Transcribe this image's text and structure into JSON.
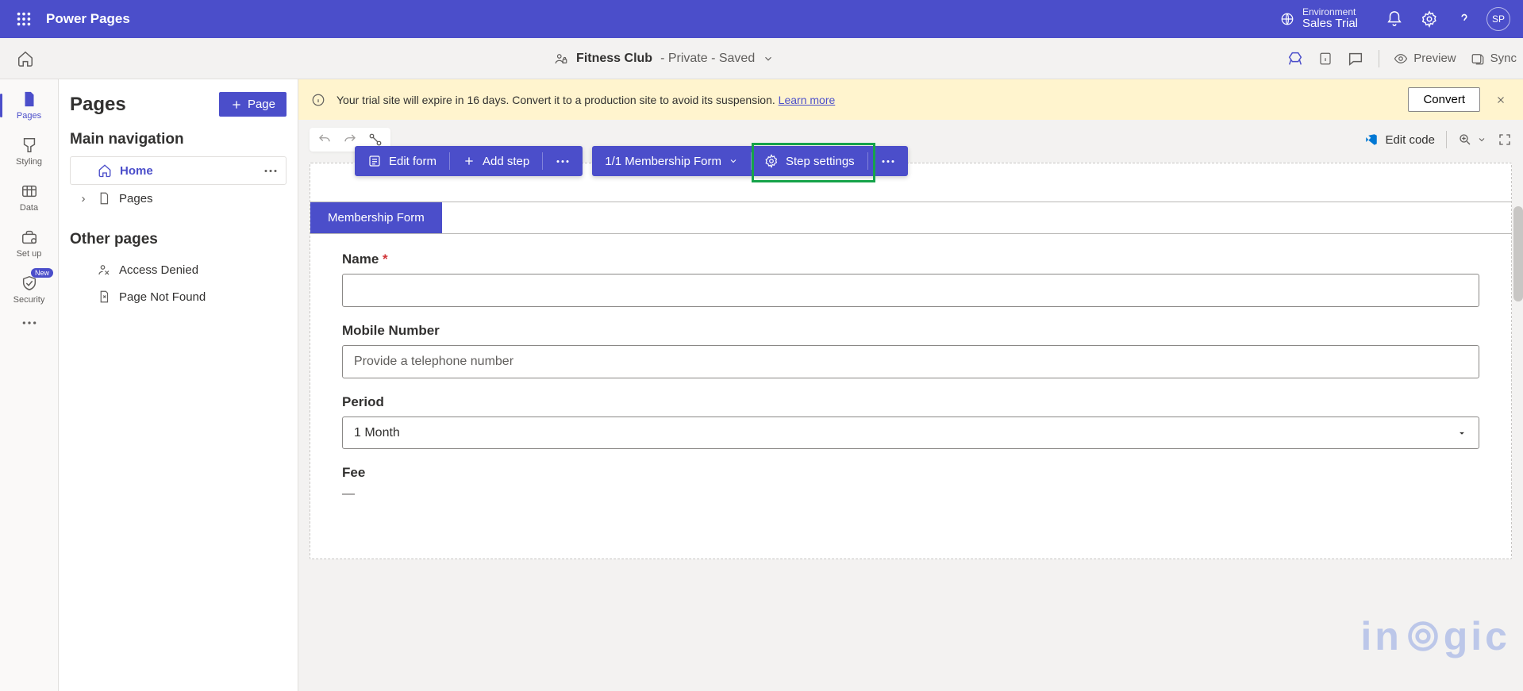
{
  "app_title": "Power Pages",
  "environment": {
    "label": "Environment",
    "name": "Sales Trial"
  },
  "avatar_initials": "SP",
  "subbar": {
    "site_name": "Fitness Club",
    "site_meta": " - Private - Saved",
    "preview": "Preview",
    "sync": "Sync"
  },
  "leftrail": {
    "pages": "Pages",
    "styling": "Styling",
    "data": "Data",
    "setup": "Set up",
    "security": "Security",
    "new_badge": "New"
  },
  "sidepanel": {
    "title": "Pages",
    "add_page": "Page",
    "main_nav": "Main navigation",
    "home": "Home",
    "pages_item": "Pages",
    "other_pages": "Other pages",
    "access_denied": "Access Denied",
    "not_found": "Page Not Found"
  },
  "banner": {
    "message_a": "Your trial site will expire in 16 days. Convert it to a production site to avoid its suspension. ",
    "learn_more": "Learn more",
    "convert": "Convert"
  },
  "toolbar": {
    "edit_code": "Edit code"
  },
  "floating": {
    "edit_form": "Edit form",
    "add_step": "Add step",
    "step_counter": "1/1 Membership Form",
    "step_settings": "Step settings"
  },
  "form": {
    "tab": "Membership Form",
    "name_label": "Name",
    "mobile_label": "Mobile Number",
    "mobile_placeholder": "Provide a telephone number",
    "period_label": "Period",
    "period_value": "1 Month",
    "fee_label": "Fee",
    "fee_value": "—"
  },
  "watermark": "in⦿gic"
}
